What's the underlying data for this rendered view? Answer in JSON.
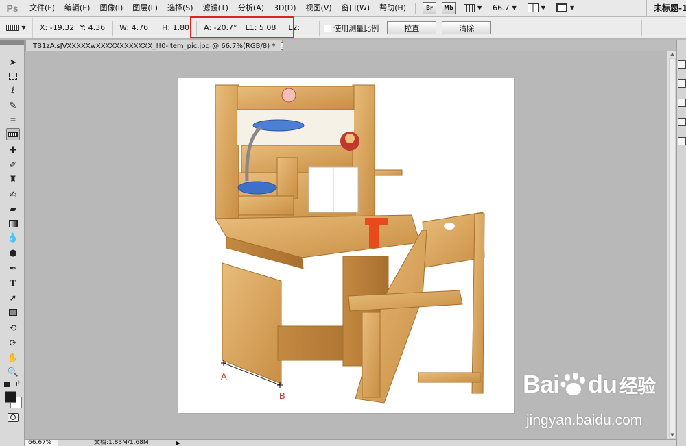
{
  "app": {
    "logo": "Ps",
    "document_title": "未标题-1"
  },
  "menu": [
    "文件(F)",
    "编辑(E)",
    "图像(I)",
    "图层(L)",
    "选择(S)",
    "滤镜(T)",
    "分析(A)",
    "3D(D)",
    "视图(V)",
    "窗口(W)",
    "帮助(H)"
  ],
  "menubar_tools": {
    "bridge": "Br",
    "mini_bridge": "Mb",
    "zoom_value": "66.7"
  },
  "options": {
    "x": "X: -19.32",
    "y": "Y: 4.36",
    "w": "W: 4.76",
    "h": "H: 1.80",
    "a": "A: -20.7°",
    "l1": "L1: 5.08",
    "l2": "L2:",
    "use_scale_label": "使用测量比例",
    "straighten_button": "拉直",
    "clear_button": "清除"
  },
  "tools": [
    "move-tool",
    "marquee-tool",
    "lasso-tool",
    "quick-selection-tool",
    "crop-tool",
    "ruler-tool",
    "healing-brush-tool",
    "brush-tool",
    "clone-stamp-tool",
    "history-brush-tool",
    "eraser-tool",
    "gradient-tool",
    "blur-tool",
    "dodge-tool",
    "pen-tool",
    "type-tool",
    "path-selection-tool",
    "rectangle-tool",
    "3d-rotate-tool",
    "3d-orbit-tool",
    "hand-tool",
    "zoom-tool"
  ],
  "active_tool": "ruler-tool",
  "document": {
    "tab_label": "TB1zA.sJVXXXXXwXXXXXXXXXXXX_!!0-item_pic.jpg @ 66.7%(RGB/8) *",
    "close_glyph": "×"
  },
  "status": {
    "zoom": "66.67%",
    "doc_info": "文档:1.83M/1.68M"
  },
  "points": {
    "a": "A",
    "b": "B"
  },
  "watermark": {
    "brand_left": "Bai",
    "brand_right": "du",
    "sub": "经验",
    "url": "jingyan.baidu.com"
  },
  "colors": {
    "highlight_box": "#d9261c",
    "point_label": "#c0392b",
    "wood": "#d9a45e"
  }
}
